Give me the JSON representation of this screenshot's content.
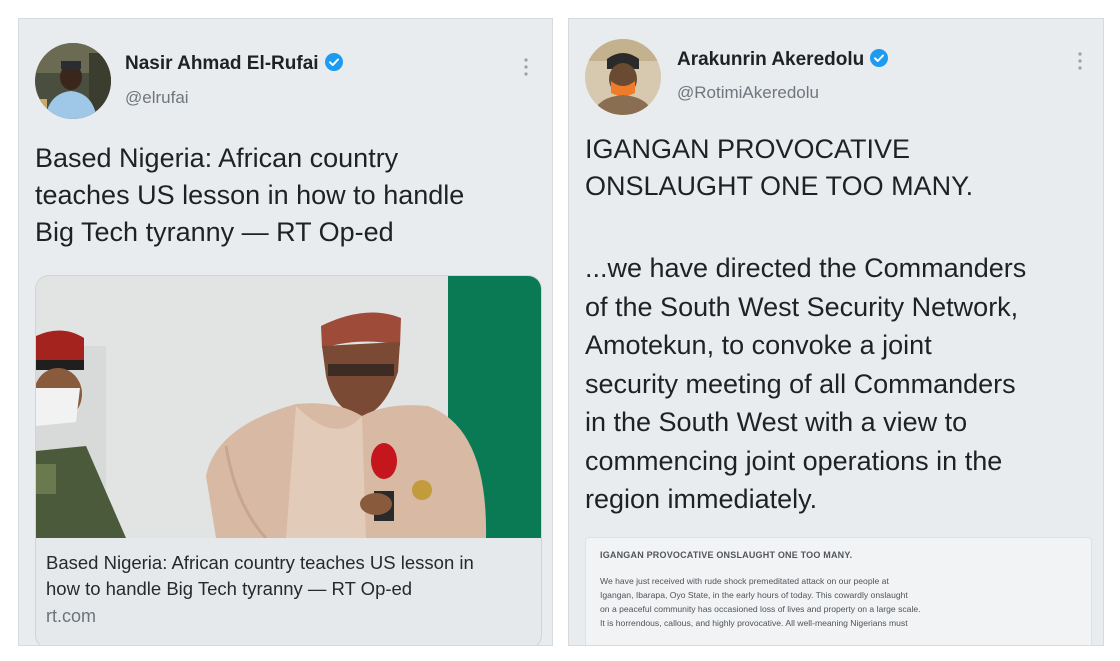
{
  "left_tweet": {
    "author_name": "Nasir Ahmad El-Rufai",
    "handle": "@elrufai",
    "verified_icon": "verified-badge-icon",
    "more_icon": "vertical-ellipsis-icon",
    "text_lines": [
      "Based Nigeria: African country",
      "teaches US lesson in how to handle",
      "Big Tech tyranny — RT Op-ed"
    ],
    "card": {
      "title_lines": [
        "Based Nigeria: African country teaches US lesson in",
        "how to handle Big Tech tyranny — RT Op-ed"
      ],
      "domain": "rt.com"
    }
  },
  "right_tweet": {
    "author_name": "Arakunrin Akeredolu",
    "handle": "@RotimiAkeredolu",
    "verified_icon": "verified-badge-icon",
    "more_icon": "vertical-ellipsis-icon",
    "headline_lines": [
      "IGANGAN PROVOCATIVE",
      "ONSLAUGHT ONE TOO MANY."
    ],
    "body_lines": [
      "...we have directed the Commanders",
      "of the South West Security Network,",
      "Amotekun, to convoke a joint",
      "security meeting of all Commanders",
      "in the South West with a view to",
      "commencing joint operations in the",
      "region immediately."
    ],
    "document": {
      "title": "IGANGAN PROVOCATIVE ONSLAUGHT ONE TOO MANY.",
      "lines": [
        "We have just received with rude shock premeditated attack on our people at",
        "Igangan, Ibarapa, Oyo State, in the early hours of today. This cowardly onslaught",
        "on a peaceful community has occasioned loss of lives and property on a large scale.",
        "It is horrendous, callous, and highly provocative. All well-meaning Nigerians must"
      ]
    }
  },
  "colors": {
    "panel_bg": "#e9ecee",
    "verified_blue": "#1d9bf0",
    "text_primary": "#1f2124",
    "text_secondary": "#6f767c"
  }
}
